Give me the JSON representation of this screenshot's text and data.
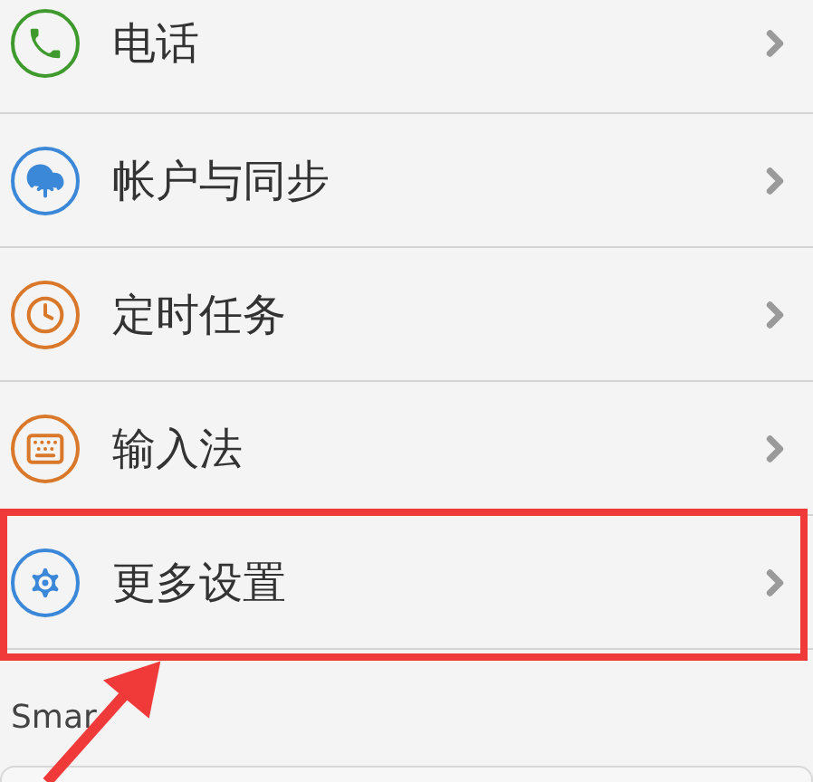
{
  "rows": [
    {
      "label": "电话",
      "kind": "phone",
      "color": "#3e9a2c",
      "highlighted": false
    },
    {
      "label": "帐户与同步",
      "kind": "cloud",
      "color": "#3b87d8",
      "highlighted": false
    },
    {
      "label": "定时任务",
      "kind": "clock",
      "color": "#d9782a",
      "highlighted": false
    },
    {
      "label": "输入法",
      "kind": "keyboard",
      "color": "#d9782a",
      "highlighted": false
    },
    {
      "label": "更多设置",
      "kind": "gear",
      "color": "#3b87d8",
      "highlighted": true
    }
  ],
  "section": {
    "title": "Smar"
  }
}
